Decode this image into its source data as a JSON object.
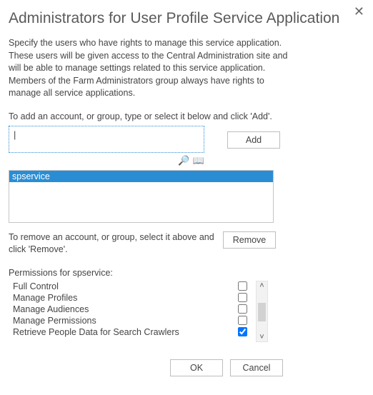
{
  "closeGlyph": "✕",
  "title": "Administrators for User Profile Service Application",
  "intro": "Specify the users who have rights to manage this service application. These users will be given access to the Central Administration site and will be able to manage settings related to this service application. Members of the Farm Administrators group always have rights to manage all service applications.",
  "addPrompt": "To add an account, or group, type or select it below and click 'Add'.",
  "inputCaret": "|",
  "addBtn": "Add",
  "checkNamesGlyph": "🔎",
  "browseGlyph": "📖",
  "selectedUser": "spservice",
  "removePrompt": "To remove an account, or group, select it above and click 'Remove'.",
  "removeBtn": "Remove",
  "permTitle": "Permissions for spservice:",
  "perms": [
    {
      "label": "Full Control",
      "checked": false
    },
    {
      "label": "Manage Profiles",
      "checked": false
    },
    {
      "label": "Manage Audiences",
      "checked": false
    },
    {
      "label": "Manage Permissions",
      "checked": false
    },
    {
      "label": "Retrieve People Data for Search Crawlers",
      "checked": true
    }
  ],
  "scrollUp": "˄",
  "scrollDown": "˅",
  "okBtn": "OK",
  "cancelBtn": "Cancel"
}
